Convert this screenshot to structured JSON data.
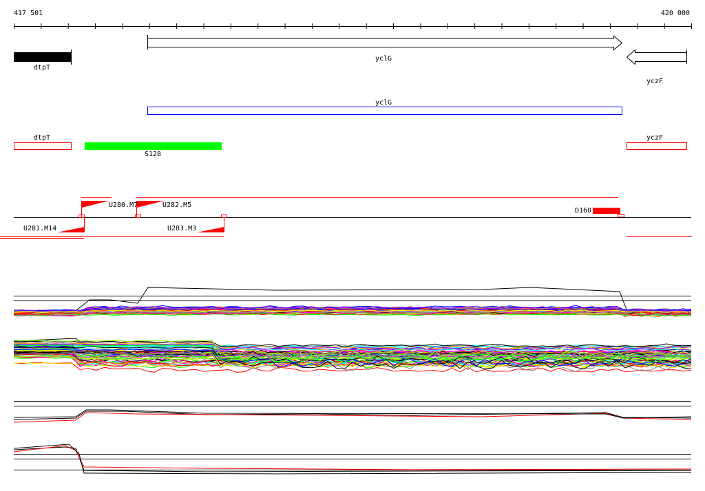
{
  "ruler": {
    "start_label": "417 501",
    "end_label": "420 000"
  },
  "genes": [
    {
      "name": "dtpT",
      "strand": "+"
    },
    {
      "name": "yclG",
      "strand": "+"
    },
    {
      "name": "yczF",
      "strand": "-"
    }
  ],
  "transcript": {
    "name": "yclG"
  },
  "annotation_boxes": [
    {
      "name": "dtpT"
    },
    {
      "name": "yczF"
    }
  ],
  "segment": {
    "name": "S128",
    "color": "#00ff00"
  },
  "breakpoints": {
    "up": [
      {
        "name": "U280.M7"
      },
      {
        "name": "U282.M5"
      }
    ],
    "down": [
      {
        "name": "U281.M14"
      },
      {
        "name": "U283.M3"
      }
    ],
    "other": [
      {
        "name": "D160"
      }
    ]
  },
  "colors": {
    "accent": "#ff0000",
    "transcript": "#0000ff",
    "segment": "#00ff00"
  }
}
